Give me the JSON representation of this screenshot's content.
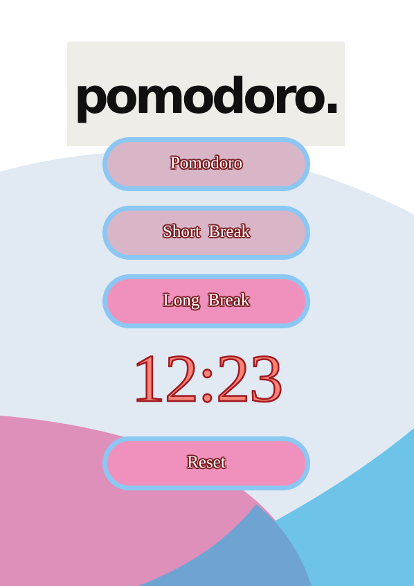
{
  "logo": {
    "text": "pomodoro."
  },
  "modes": {
    "pomodoro_label": "Pomodoro",
    "short_break_label": "Short Break",
    "long_break_label": "Long Break",
    "active": "Long Break"
  },
  "timer": {
    "display": "12:23"
  },
  "controls": {
    "reset_label": "Reset"
  },
  "colors": {
    "logo_bg": "#efede8",
    "button_border": "#8cc7f3",
    "button_inactive": "#d8b6c8",
    "button_active": "#f090bc",
    "text_outline": "#7a1a1e",
    "timer_fill": "#f88478",
    "timer_outline": "#a01820",
    "bg_light_blue": "#e1eaf3",
    "bg_pink": "#de8fba",
    "bg_blue": "#6ec3e8",
    "bg_overlap": "#6ea3d2"
  }
}
